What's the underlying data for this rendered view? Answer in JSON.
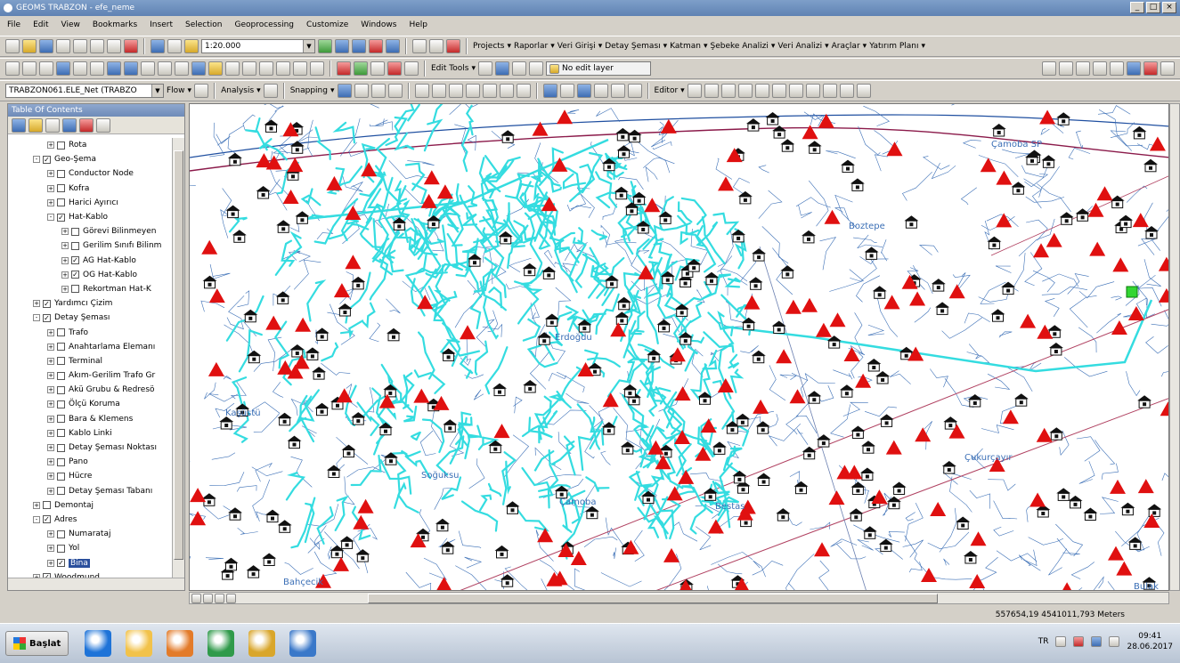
{
  "window": {
    "title": "GEOMS TRABZON - efe_neme"
  },
  "menu": [
    "File",
    "Edit",
    "View",
    "Bookmarks",
    "Insert",
    "Selection",
    "Geoprocessing",
    "Customize",
    "Windows",
    "Help"
  ],
  "toolbar1": {
    "scale": "1:20.000",
    "menus": [
      "Projects",
      "Raporlar",
      "Veri Girişi",
      "Detay Şeması",
      "Katman",
      "Şebeke Analizi",
      "Veri Analizi",
      "Araçlar",
      "Yatırım Planı"
    ]
  },
  "toolbar2": {
    "edit_tools": "Edit Tools",
    "edit_layer": "No edit layer"
  },
  "toolbar3": {
    "layer": "TRABZON061.ELE_Net (TRABZO",
    "flow": "Flow",
    "analysis": "Analysis",
    "snapping": "Snapping",
    "editor": "Editor"
  },
  "toc": {
    "title": "Table Of Contents",
    "items": [
      {
        "indent": 1,
        "exp": "+",
        "checked": false,
        "label": "Rota"
      },
      {
        "indent": 0,
        "exp": "-",
        "checked": true,
        "label": "Geo-Şema"
      },
      {
        "indent": 1,
        "exp": "+",
        "checked": false,
        "label": "Conductor Node"
      },
      {
        "indent": 1,
        "exp": "+",
        "checked": false,
        "label": "Kofra"
      },
      {
        "indent": 1,
        "exp": "+",
        "checked": false,
        "label": "Harici Ayırıcı"
      },
      {
        "indent": 1,
        "exp": "-",
        "checked": true,
        "label": "Hat-Kablo"
      },
      {
        "indent": 2,
        "exp": "+",
        "checked": false,
        "label": "Görevi Bilinmeyen"
      },
      {
        "indent": 2,
        "exp": "+",
        "checked": false,
        "label": "Gerilim Sınıfı Bilinm"
      },
      {
        "indent": 2,
        "exp": "+",
        "checked": true,
        "label": "AG Hat-Kablo"
      },
      {
        "indent": 2,
        "exp": "+",
        "checked": true,
        "label": "OG Hat-Kablo"
      },
      {
        "indent": 2,
        "exp": "+",
        "checked": false,
        "label": "Rekortman Hat-K"
      },
      {
        "indent": 0,
        "exp": "+",
        "checked": true,
        "label": "Yardımcı Çizim"
      },
      {
        "indent": 0,
        "exp": "-",
        "checked": true,
        "label": "Detay Şeması"
      },
      {
        "indent": 1,
        "exp": "+",
        "checked": false,
        "label": "Trafo"
      },
      {
        "indent": 1,
        "exp": "+",
        "checked": false,
        "label": "Anahtarlama Elemanı"
      },
      {
        "indent": 1,
        "exp": "+",
        "checked": false,
        "label": "Terminal"
      },
      {
        "indent": 1,
        "exp": "+",
        "checked": false,
        "label": "Akım-Gerilim Trafo Gr"
      },
      {
        "indent": 1,
        "exp": "+",
        "checked": false,
        "label": "Akü Grubu & Redresö"
      },
      {
        "indent": 1,
        "exp": "+",
        "checked": false,
        "label": "Ölçü Koruma"
      },
      {
        "indent": 1,
        "exp": "+",
        "checked": false,
        "label": "Bara & Klemens"
      },
      {
        "indent": 1,
        "exp": "+",
        "checked": false,
        "label": "Kablo Linki"
      },
      {
        "indent": 1,
        "exp": "+",
        "checked": false,
        "label": "Detay Şeması Noktası"
      },
      {
        "indent": 1,
        "exp": "+",
        "checked": false,
        "label": "Pano"
      },
      {
        "indent": 1,
        "exp": "+",
        "checked": false,
        "label": "Hücre"
      },
      {
        "indent": 1,
        "exp": "+",
        "checked": false,
        "label": "Detay Şeması Tabanı"
      },
      {
        "indent": 0,
        "exp": "+",
        "checked": false,
        "label": "Demontaj"
      },
      {
        "indent": 0,
        "exp": "-",
        "checked": true,
        "label": "Adres"
      },
      {
        "indent": 1,
        "exp": "+",
        "checked": false,
        "label": "Numarataj"
      },
      {
        "indent": 1,
        "exp": "+",
        "checked": false,
        "label": "Yol"
      },
      {
        "indent": 1,
        "exp": "+",
        "checked": true,
        "label": "Bina",
        "selected": true
      },
      {
        "indent": 0,
        "exp": "+",
        "checked": true,
        "label": "Woodmund"
      }
    ]
  },
  "map_labels": [
    "Çamoba SP",
    "Boztepe",
    "Erdoğdu",
    "Soğuksu",
    "Çamoba",
    "Bestas",
    "Bulak",
    "Kaşüstü",
    "Çukurçayır",
    "Bahçecik"
  ],
  "status": {
    "coords": "557654,19  4541011,793 Meters"
  },
  "taskbar": {
    "start": "Başlat",
    "lang": "TR",
    "time": "09:41",
    "date": "28.06.2017",
    "apps": [
      {
        "name": "ie",
        "color": "#1e73d8"
      },
      {
        "name": "explorer",
        "color": "#f2c24a"
      },
      {
        "name": "media",
        "color": "#e37b2a"
      },
      {
        "name": "gn",
        "color": "#2f9a4a"
      },
      {
        "name": "arcmap",
        "color": "#d9a62b"
      },
      {
        "name": "search",
        "color": "#3a78c9"
      }
    ]
  }
}
